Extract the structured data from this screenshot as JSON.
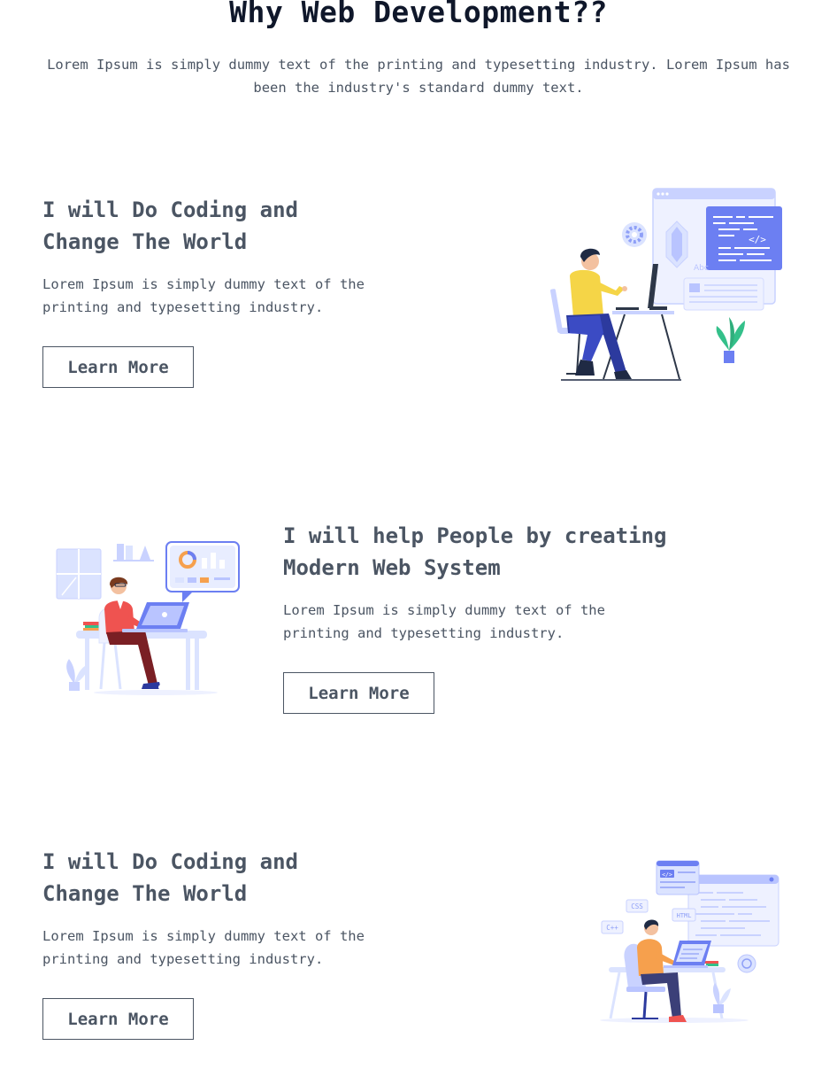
{
  "header": {
    "title": "Why Web Development??",
    "intro": "Lorem Ipsum is simply dummy text of the printing and typesetting industry. Lorem Ipsum has been the industry's standard dummy text."
  },
  "features": [
    {
      "title_line1": "I will Do Coding and",
      "title_line2": "Change The World",
      "text_line1": "Lorem Ipsum is simply dummy text of the",
      "text_line2": "printing and typesetting industry.",
      "button": "Learn More"
    },
    {
      "title_line1": "I will help People by creating",
      "title_line2": "Modern Web System",
      "text_line1": "Lorem Ipsum is simply dummy text of the",
      "text_line2": "printing and typesetting industry.",
      "button": "Learn More"
    },
    {
      "title_line1": "I will Do Coding and",
      "title_line2": "Change The World",
      "text_line1": "Lorem Ipsum is simply dummy text of the",
      "text_line2": "printing and typesetting industry.",
      "button": "Learn More"
    }
  ],
  "illustrations": {
    "one": {
      "code_tag": "</>",
      "abc_label": "Abc"
    },
    "three": {
      "css_label": "CSS",
      "cpp_label": "C++",
      "html_label": "HTML",
      "code_tag": "</>"
    }
  },
  "colors": {
    "title": "#0f172a",
    "text": "#4b5563",
    "accent_blue": "#6c7ff2",
    "light_blue": "#dbe3ff",
    "yellow": "#f5d547",
    "navy": "#2c3a9e",
    "green": "#34c08a",
    "red": "#ef5350",
    "orange": "#f6a04d"
  }
}
